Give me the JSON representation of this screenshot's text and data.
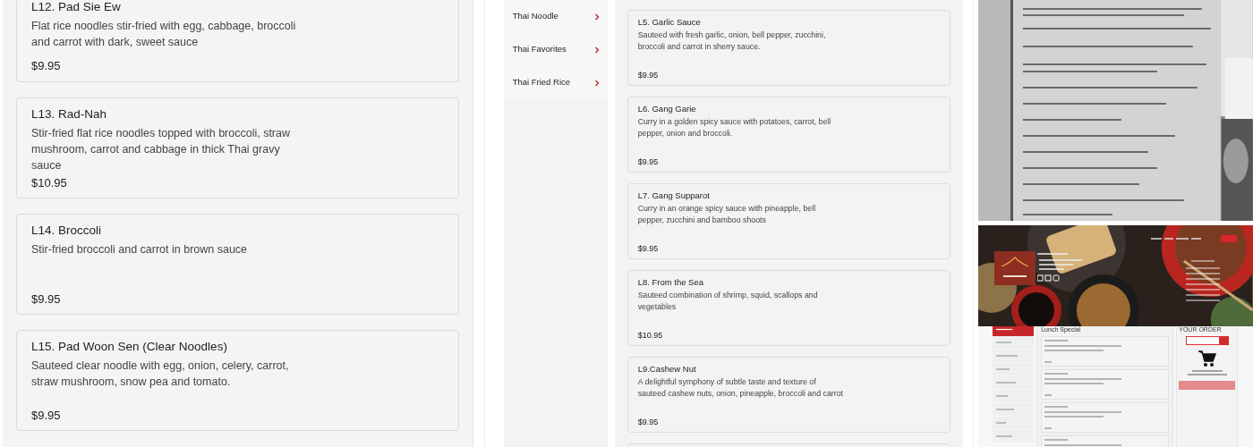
{
  "left_panel": {
    "items": [
      {
        "name": "L12. Pad Sie Ew",
        "description": "Flat rice noodles stir-fried with egg, cabbage, broccoli and carrot with dark, sweet sauce",
        "price": "$9.95"
      },
      {
        "name": "L13. Rad-Nah",
        "description": "Stir-fried flat rice noodles topped with broccoli, straw mushroom, carrot and cabbage in thick Thai gravy sauce",
        "price": "$10.95"
      },
      {
        "name": "L14. Broccoli",
        "description": "Stir-fried broccoli and carrot in brown sauce",
        "price": "$9.95"
      },
      {
        "name": "L15. Pad Woon Sen (Clear Noodles)",
        "description": "Sauteed clear noodle with egg, onion, celery, carrot, straw mushroom, snow pea and tomato.",
        "price": "$9.95"
      }
    ]
  },
  "middle_panel": {
    "categories": [
      {
        "label": "Thai Noodle",
        "selected": false
      },
      {
        "label": "Thai Favorites",
        "selected": false
      },
      {
        "label": "Thai Fried Rice",
        "selected": false
      }
    ],
    "items": [
      {
        "name": "L5. Garlic Sauce",
        "description": "Sauteed with fresh garlic, onion, bell pepper, zucchini, broccoli and carrot in sherry sauce.",
        "price": "$9.95"
      },
      {
        "name": "L6. Gang Garie",
        "description": "Curry in a golden spicy sauce with potatoes, carrot, bell pepper, onion and broccoli.",
        "price": "$9.95"
      },
      {
        "name": "L7. Gang Supparot",
        "description": "Curry in an orange spicy sauce with pineapple, bell pepper, zucchini and bamboo shoots",
        "price": "$9.95"
      },
      {
        "name": "L8. From the Sea",
        "description": "Sauteed combination of shrimp, squid, scallops and vegetables",
        "price": "$10.95"
      },
      {
        "name": "L9.Cashew Nut",
        "description": "A delightful symphony of subtle taste and texture of sauteed cashew nuts, onion, pineapple, broccoli and carrot",
        "price": "$9.95"
      }
    ]
  },
  "website": {
    "section_title": "Lunch Special",
    "order_title": "YOUR ORDER"
  }
}
